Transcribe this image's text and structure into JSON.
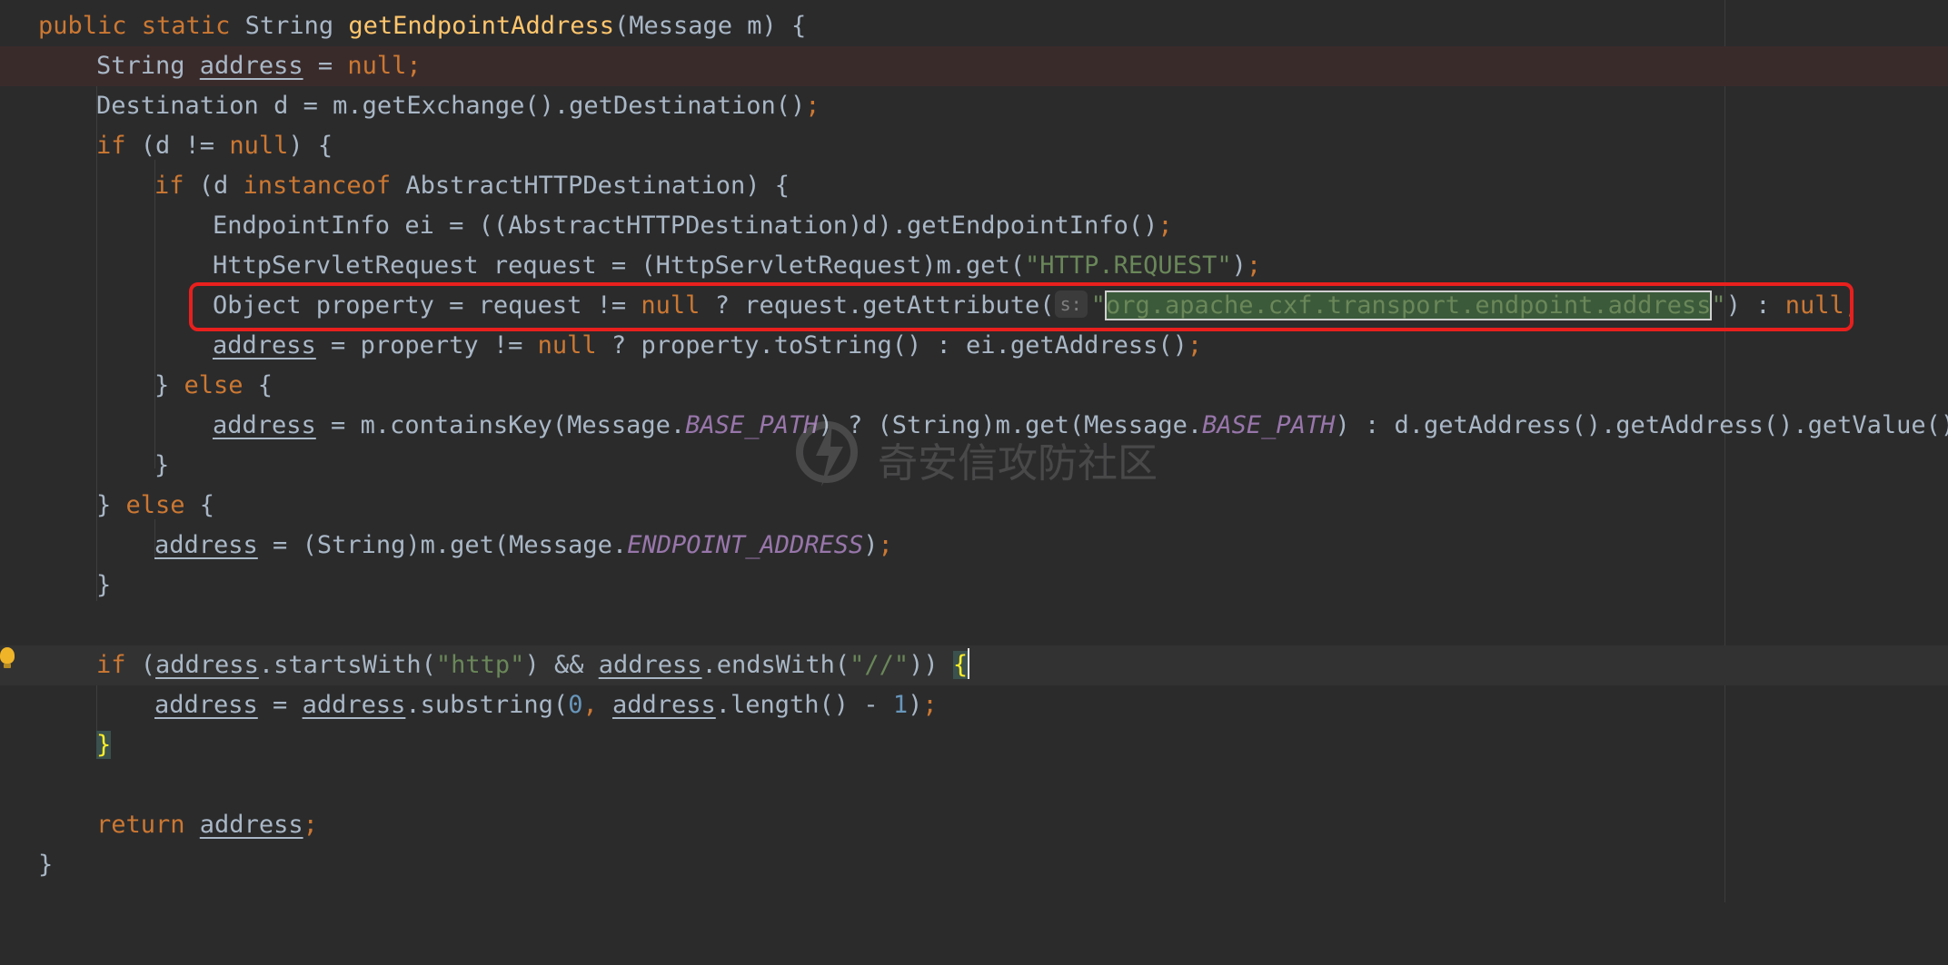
{
  "editor": {
    "lines": {
      "l1": {
        "t0": "public static ",
        "t1": "String ",
        "t2": "getEndpointAddress",
        "t3": "(Message m) {"
      },
      "l2": {
        "t0": "String ",
        "t1": "address",
        "t2": " = ",
        "t3": "null",
        "t4": ";"
      },
      "l3": {
        "t0": "Destination d = m.getExchange().getDestination()",
        "t1": ";"
      },
      "l4": {
        "t0": "if",
        "t1": " (d != ",
        "t2": "null",
        "t3": ") {"
      },
      "l5": {
        "t0": "if",
        "t1": " (d ",
        "t2": "instanceof",
        "t3": " AbstractHTTPDestination) {"
      },
      "l6": {
        "t0": "EndpointInfo ei = ((AbstractHTTPDestination)d).getEndpointInfo()",
        "t1": ";"
      },
      "l7": {
        "t0": "HttpServletRequest request = (HttpServletRequest)m.get(",
        "t1": "\"HTTP.REQUEST\"",
        "t2": ")",
        "t3": ";"
      },
      "l8": {
        "t0": "Object property = request != ",
        "t1": "null",
        "t2": " ? request.getAttribute(",
        "hint": "s:",
        "t3": "\"",
        "t4": "org.apache.cxf.transport.endpoint.address",
        "t5": "\"",
        "t6": ") : ",
        "t7": "null",
        "t8": ";"
      },
      "l9": {
        "t0": "address",
        "t1": " = property != ",
        "t2": "null",
        "t3": " ? property.toString() : ei.getAddress()",
        "t4": ";"
      },
      "l10": {
        "t0": "} ",
        "t1": "else",
        "t2": " {"
      },
      "l11": {
        "t0": "address",
        "t1": " = m.containsKey(Message.",
        "t2": "BASE_PATH",
        "t3": ") ? (String)m.get(Message.",
        "t4": "BASE_PATH",
        "t5": ") : d.getAddress().getAddress().getValue()",
        "t6": ";"
      },
      "l12": {
        "t0": "}"
      },
      "l13": {
        "t0": "} ",
        "t1": "else",
        "t2": " {"
      },
      "l14": {
        "t0": "address",
        "t1": " = (String)m.get(Message.",
        "t2": "ENDPOINT_ADDRESS",
        "t3": ")",
        "t4": ";"
      },
      "l15": {
        "t0": "}"
      },
      "l16": {
        "t0": "if",
        "t1": " (",
        "t2": "address",
        "t3": ".startsWith(",
        "t4": "\"http\"",
        "t5": ") && ",
        "t6": "address",
        "t7": ".endsWith(",
        "t8": "\"//\"",
        "t9": ")) ",
        "t10": "{"
      },
      "l17": {
        "t0": "address",
        "t1": " = ",
        "t2": "address",
        "t3": ".substring(",
        "t4": "0",
        "t5": ", ",
        "t6": "address",
        "t7": ".length() - ",
        "t8": "1",
        "t9": ")",
        "t10": ";"
      },
      "l18": {
        "t0": "}"
      },
      "l19": {
        "t0": "return ",
        "t1": "address",
        "t2": ";"
      },
      "l20": {
        "t0": "}"
      }
    }
  },
  "watermark": {
    "text": "奇安信攻防社区"
  },
  "colors": {
    "background": "#2b2b2c",
    "keyword": "#cc7832",
    "method": "#ffc66d",
    "string": "#6a8759",
    "number": "#6897bb",
    "constant": "#9876aa",
    "highlight_box": "#e8201d"
  }
}
